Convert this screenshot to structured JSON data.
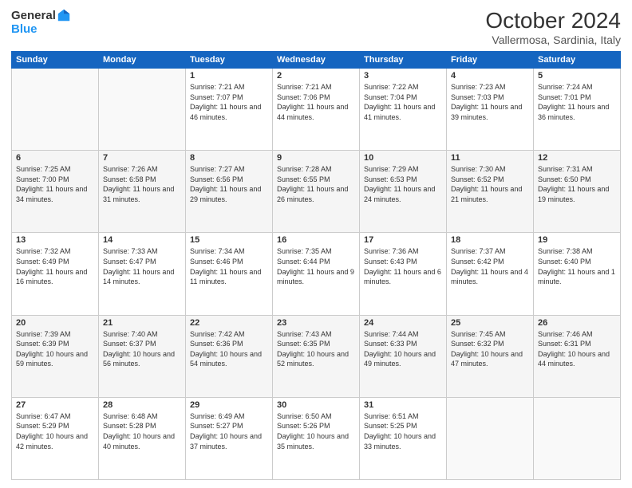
{
  "header": {
    "logo": {
      "general": "General",
      "blue": "Blue"
    },
    "title": "October 2024",
    "location": "Vallermosa, Sardinia, Italy"
  },
  "calendar": {
    "weekdays": [
      "Sunday",
      "Monday",
      "Tuesday",
      "Wednesday",
      "Thursday",
      "Friday",
      "Saturday"
    ],
    "weeks": [
      [
        {
          "day": "",
          "info": ""
        },
        {
          "day": "",
          "info": ""
        },
        {
          "day": "1",
          "info": "Sunrise: 7:21 AM\nSunset: 7:07 PM\nDaylight: 11 hours and 46 minutes."
        },
        {
          "day": "2",
          "info": "Sunrise: 7:21 AM\nSunset: 7:06 PM\nDaylight: 11 hours and 44 minutes."
        },
        {
          "day": "3",
          "info": "Sunrise: 7:22 AM\nSunset: 7:04 PM\nDaylight: 11 hours and 41 minutes."
        },
        {
          "day": "4",
          "info": "Sunrise: 7:23 AM\nSunset: 7:03 PM\nDaylight: 11 hours and 39 minutes."
        },
        {
          "day": "5",
          "info": "Sunrise: 7:24 AM\nSunset: 7:01 PM\nDaylight: 11 hours and 36 minutes."
        }
      ],
      [
        {
          "day": "6",
          "info": "Sunrise: 7:25 AM\nSunset: 7:00 PM\nDaylight: 11 hours and 34 minutes."
        },
        {
          "day": "7",
          "info": "Sunrise: 7:26 AM\nSunset: 6:58 PM\nDaylight: 11 hours and 31 minutes."
        },
        {
          "day": "8",
          "info": "Sunrise: 7:27 AM\nSunset: 6:56 PM\nDaylight: 11 hours and 29 minutes."
        },
        {
          "day": "9",
          "info": "Sunrise: 7:28 AM\nSunset: 6:55 PM\nDaylight: 11 hours and 26 minutes."
        },
        {
          "day": "10",
          "info": "Sunrise: 7:29 AM\nSunset: 6:53 PM\nDaylight: 11 hours and 24 minutes."
        },
        {
          "day": "11",
          "info": "Sunrise: 7:30 AM\nSunset: 6:52 PM\nDaylight: 11 hours and 21 minutes."
        },
        {
          "day": "12",
          "info": "Sunrise: 7:31 AM\nSunset: 6:50 PM\nDaylight: 11 hours and 19 minutes."
        }
      ],
      [
        {
          "day": "13",
          "info": "Sunrise: 7:32 AM\nSunset: 6:49 PM\nDaylight: 11 hours and 16 minutes."
        },
        {
          "day": "14",
          "info": "Sunrise: 7:33 AM\nSunset: 6:47 PM\nDaylight: 11 hours and 14 minutes."
        },
        {
          "day": "15",
          "info": "Sunrise: 7:34 AM\nSunset: 6:46 PM\nDaylight: 11 hours and 11 minutes."
        },
        {
          "day": "16",
          "info": "Sunrise: 7:35 AM\nSunset: 6:44 PM\nDaylight: 11 hours and 9 minutes."
        },
        {
          "day": "17",
          "info": "Sunrise: 7:36 AM\nSunset: 6:43 PM\nDaylight: 11 hours and 6 minutes."
        },
        {
          "day": "18",
          "info": "Sunrise: 7:37 AM\nSunset: 6:42 PM\nDaylight: 11 hours and 4 minutes."
        },
        {
          "day": "19",
          "info": "Sunrise: 7:38 AM\nSunset: 6:40 PM\nDaylight: 11 hours and 1 minute."
        }
      ],
      [
        {
          "day": "20",
          "info": "Sunrise: 7:39 AM\nSunset: 6:39 PM\nDaylight: 10 hours and 59 minutes."
        },
        {
          "day": "21",
          "info": "Sunrise: 7:40 AM\nSunset: 6:37 PM\nDaylight: 10 hours and 56 minutes."
        },
        {
          "day": "22",
          "info": "Sunrise: 7:42 AM\nSunset: 6:36 PM\nDaylight: 10 hours and 54 minutes."
        },
        {
          "day": "23",
          "info": "Sunrise: 7:43 AM\nSunset: 6:35 PM\nDaylight: 10 hours and 52 minutes."
        },
        {
          "day": "24",
          "info": "Sunrise: 7:44 AM\nSunset: 6:33 PM\nDaylight: 10 hours and 49 minutes."
        },
        {
          "day": "25",
          "info": "Sunrise: 7:45 AM\nSunset: 6:32 PM\nDaylight: 10 hours and 47 minutes."
        },
        {
          "day": "26",
          "info": "Sunrise: 7:46 AM\nSunset: 6:31 PM\nDaylight: 10 hours and 44 minutes."
        }
      ],
      [
        {
          "day": "27",
          "info": "Sunrise: 6:47 AM\nSunset: 5:29 PM\nDaylight: 10 hours and 42 minutes."
        },
        {
          "day": "28",
          "info": "Sunrise: 6:48 AM\nSunset: 5:28 PM\nDaylight: 10 hours and 40 minutes."
        },
        {
          "day": "29",
          "info": "Sunrise: 6:49 AM\nSunset: 5:27 PM\nDaylight: 10 hours and 37 minutes."
        },
        {
          "day": "30",
          "info": "Sunrise: 6:50 AM\nSunset: 5:26 PM\nDaylight: 10 hours and 35 minutes."
        },
        {
          "day": "31",
          "info": "Sunrise: 6:51 AM\nSunset: 5:25 PM\nDaylight: 10 hours and 33 minutes."
        },
        {
          "day": "",
          "info": ""
        },
        {
          "day": "",
          "info": ""
        }
      ]
    ]
  }
}
